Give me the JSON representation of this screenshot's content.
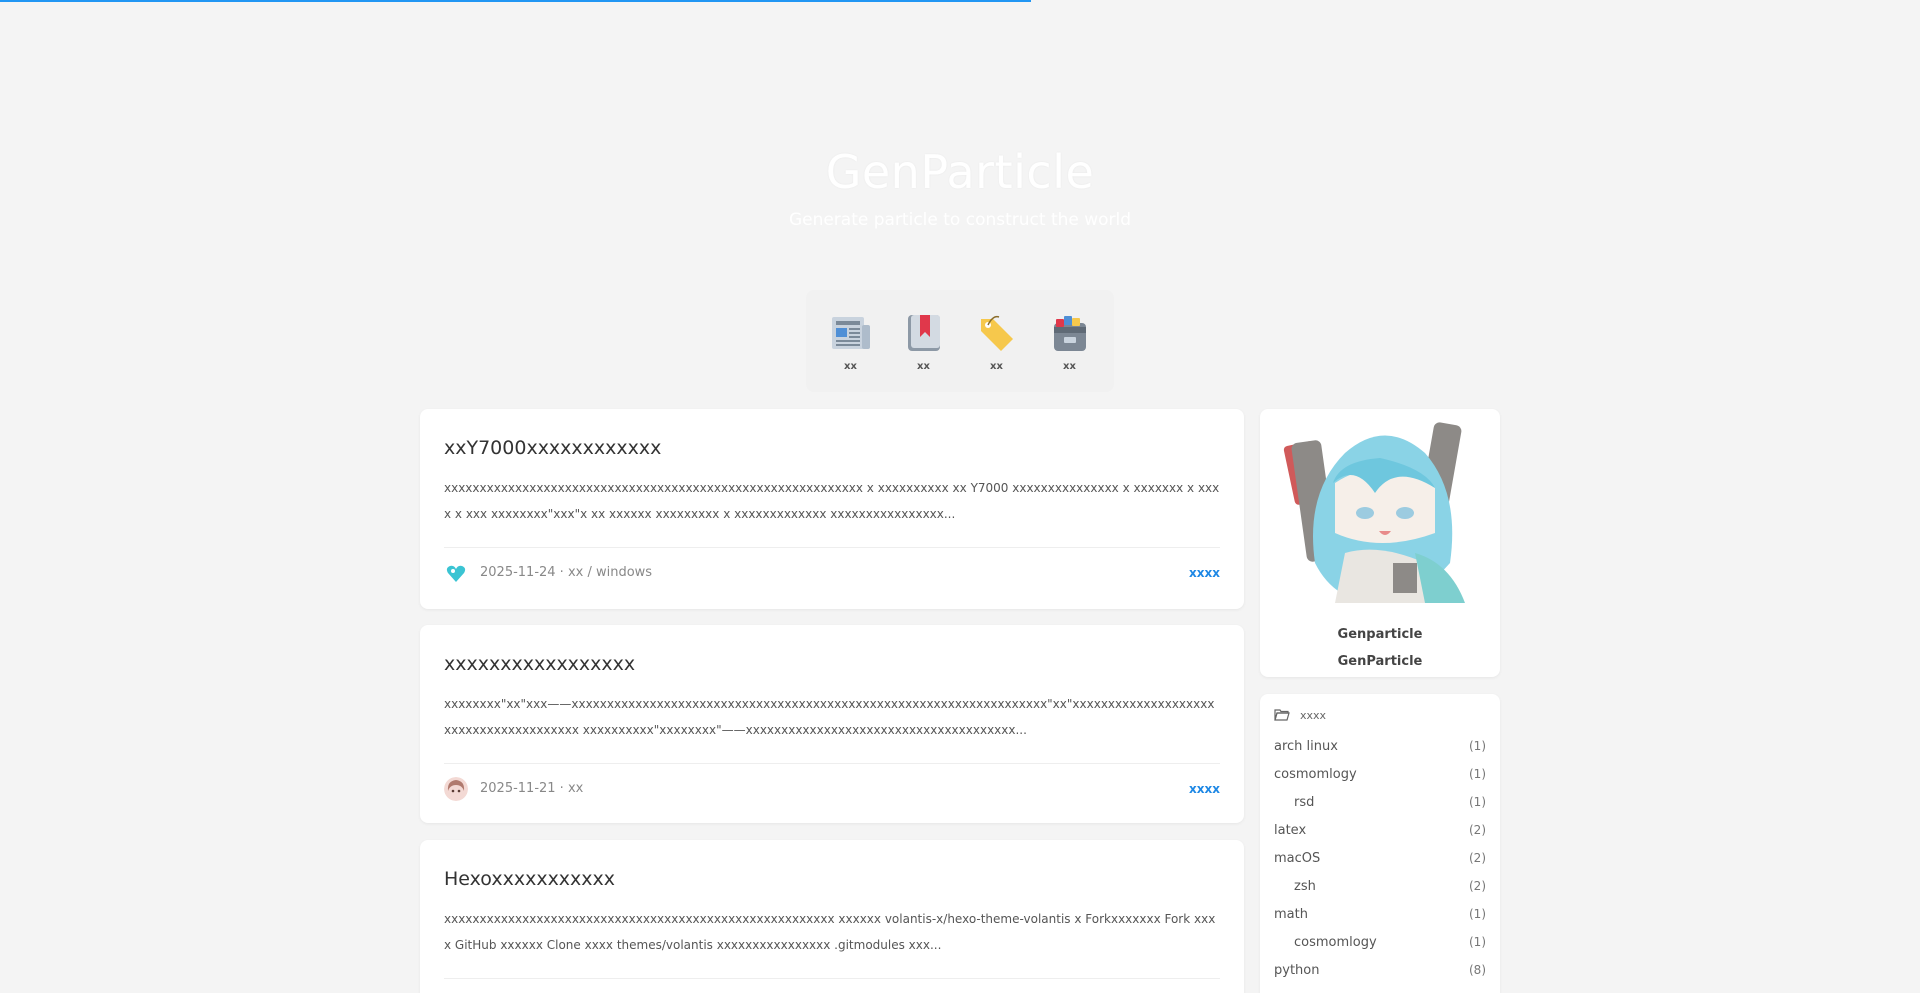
{
  "site": {
    "title": "GenParticle",
    "subtitle": "Generate particle to construct the world"
  },
  "page_progress": 0.537,
  "nav": [
    {
      "label": "xx",
      "icon": "newspaper-icon"
    },
    {
      "label": "xx",
      "icon": "bookmark-book-icon"
    },
    {
      "label": "xx",
      "icon": "tag-icon"
    },
    {
      "label": "xx",
      "icon": "archive-box-icon"
    }
  ],
  "posts": [
    {
      "title": "xxY7000xxxxxxxxxxxx",
      "excerpt": "xxxxxxxxxxxxxxxxxxxxxxxxxxxxxxxxxxxxxxxxxxxxxxxxxxxxxxxxxxx x xxxxxxxxxx xx Y7000 xxxxxxxxxxxxxxx x xxxxxxx x xxxx x xxx xxxxxxxx\"xxx\"x xx xxxxxx xxxxxxxxx x xxxxxxxxxxxxx xxxxxxxxxxxxxxxx...",
      "meta": "2025-11-24 · xx / windows",
      "read_more": "xxxx",
      "avatar": "miku-heart-avatar-icon"
    },
    {
      "title": "xxxxxxxxxxxxxxxxx",
      "excerpt": "xxxxxxxx\"xx\"xxx——xxxxxxxxxxxxxxxxxxxxxxxxxxxxxxxxxxxxxxxxxxxxxxxxxxxxxxxxxxxxxxxxxxx\"xx\"xxxxxxxxxxxxxxxxxxxxxxxxxxxxxxxxxxxxxxx xxxxxxxxxx\"xxxxxxxx\"——xxxxxxxxxxxxxxxxxxxxxxxxxxxxxxxxxxxxxx...",
      "meta": "2025-11-21 · xx",
      "read_more": "xxxx",
      "avatar": "girl-avatar-icon"
    },
    {
      "title": "Hexoxxxxxxxxxxx",
      "excerpt": "xxxxxxxxxxxxxxxxxxxxxxxxxxxxxxxxxxxxxxxxxxxxxxxxxxxxxxx xxxxxx volantis-x/hexo-theme-volantis x Forkxxxxxxx Fork xxxx GitHub xxxxxx Clone xxxx themes/volantis xxxxxxxxxxxxxxxx .gitmodules xxx...",
      "meta": "",
      "read_more": "",
      "avatar": ""
    }
  ],
  "profile": {
    "name": "Genparticle",
    "subname": "GenParticle",
    "avatar": "miku-chibi-avatar"
  },
  "categories": {
    "header": "xxxx",
    "items": [
      {
        "name": "arch linux",
        "count": "(1)",
        "child": false
      },
      {
        "name": "cosmomlogy",
        "count": "(1)",
        "child": false
      },
      {
        "name": "rsd",
        "count": "(1)",
        "child": true
      },
      {
        "name": "latex",
        "count": "(2)",
        "child": false
      },
      {
        "name": "macOS",
        "count": "(2)",
        "child": false
      },
      {
        "name": "zsh",
        "count": "(2)",
        "child": true
      },
      {
        "name": "math",
        "count": "(1)",
        "child": false
      },
      {
        "name": "cosmomlogy",
        "count": "(1)",
        "child": true
      },
      {
        "name": "python",
        "count": "(8)",
        "child": false
      }
    ]
  },
  "colors": {
    "accent": "#2196f3",
    "link": "#1e88e5",
    "background": "#f4f4f4"
  }
}
